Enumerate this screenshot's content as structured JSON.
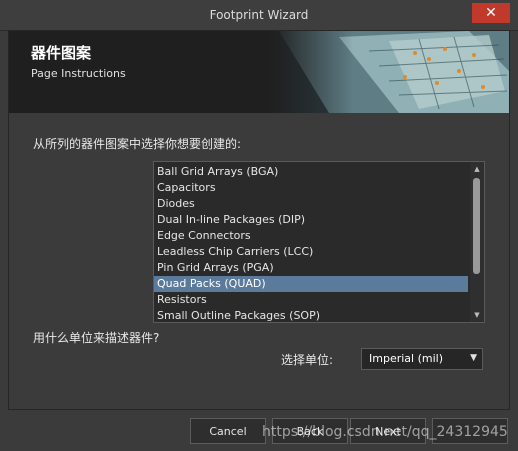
{
  "window": {
    "title": "Footprint Wizard",
    "close_glyph": "✕"
  },
  "banner": {
    "title": "器件图案",
    "subtitle": "Page Instructions"
  },
  "pattern": {
    "prompt": "从所列的器件图案中选择你想要创建的:",
    "items": [
      "Ball Grid Arrays (BGA)",
      "Capacitors",
      "Diodes",
      "Dual In-line Packages (DIP)",
      "Edge Connectors",
      "Leadless Chip Carriers (LCC)",
      "Pin Grid Arrays (PGA)",
      "Quad Packs (QUAD)",
      "Resistors",
      "Small Outline Packages (SOP)"
    ],
    "selected_index": 7
  },
  "units": {
    "prompt": "用什么单位来描述器件?",
    "label": "选择单位:",
    "value": "Imperial (mil)"
  },
  "buttons": {
    "cancel": "Cancel",
    "back": "Back",
    "next": "Next",
    "finish": ""
  },
  "watermark": "https://blog.csdn.net/qq_24312945",
  "colors": {
    "selection": "#5b7a9c",
    "close_button": "#c0392b"
  }
}
